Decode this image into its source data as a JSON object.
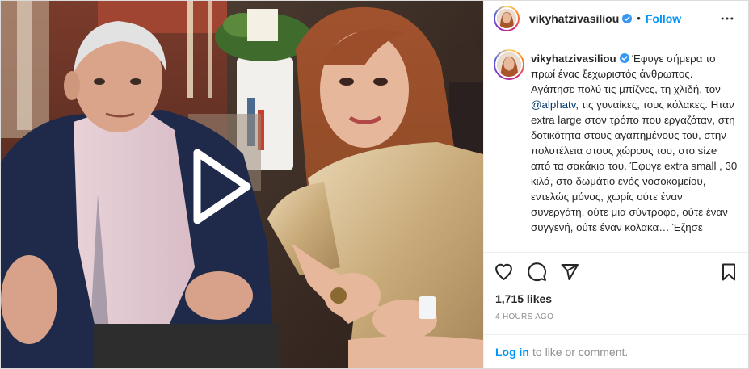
{
  "post": {
    "username": "vikyhatzivasiliou",
    "follow_label": "Follow",
    "separator": "•",
    "caption": {
      "before_mention": "Έφυγε σήμερα το πρωί ένας ξεχωριστός άνθρωπος. Αγάπησε πολύ τις μπίζνες, τη χλιδή, τον ",
      "mention": "@alphatv",
      "after_mention": ", τις γυναίκες, τους κόλακες. Ηταν extra large στον τρόπο που εργαζόταν, στη δοτικότητα στους αγαπημένους του, στην πολυτέλεια στους χώρους του, στο size από τα σακάκια του. Έφυγε extra small , 30 κιλά, στο δωμάτιο ενός νοσοκομείου, εντελώς μόνος, χωρίς ούτε έναν συνεργάτη, ούτε μια σύντροφο, ούτε έναν συγγενή, ούτε έναν κολακα… Έζησε"
    },
    "likes": "1,715 likes",
    "time_ago": "4 HOURS AGO"
  },
  "footer": {
    "login_label": "Log in",
    "login_suffix": "to like or comment."
  },
  "icons": {
    "like": "heart-icon",
    "comment": "comment-icon",
    "share": "share-icon",
    "save": "bookmark-icon",
    "more": "more-horizontal-icon",
    "verified": "verified-badge-icon",
    "play": "play-icon"
  },
  "colors": {
    "link": "#0095f6",
    "mention": "#00376b",
    "muted": "#8e8e8e",
    "verified": "#3897f0"
  }
}
